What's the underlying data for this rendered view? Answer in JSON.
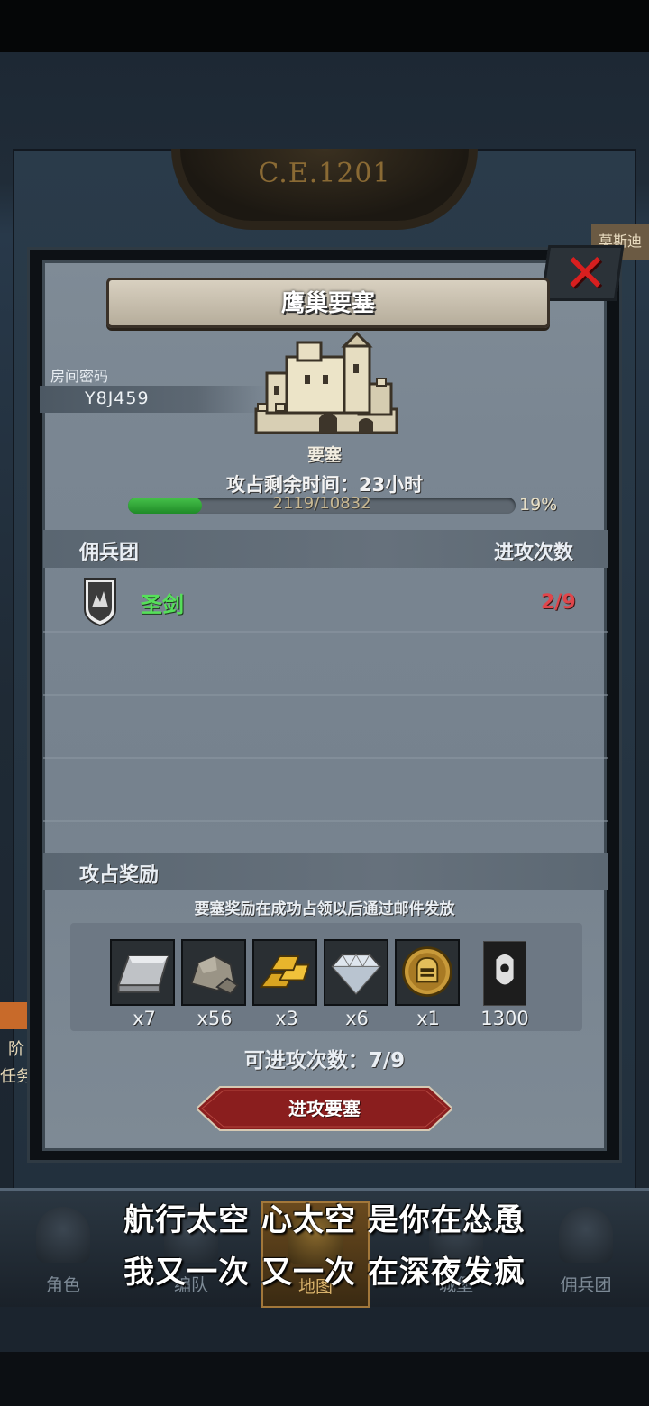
{
  "background": {
    "era": "C.E.1201",
    "right_tab": "莫斯迪",
    "side_left": [
      "阶",
      "任务"
    ]
  },
  "modal": {
    "title": "鹰巢要塞",
    "room_password_label": "房间密码",
    "room_password_value": "Y8J459",
    "fortress_name": "要塞",
    "timer_label": "攻占剩余时间：23小时",
    "progress": {
      "current": 2119,
      "total": 10832,
      "text": "2119/10832",
      "percent_text": "19%",
      "percent": 19
    },
    "guild_section": {
      "title": "佣兵团",
      "right_label": "进攻次数",
      "rows": [
        {
          "name": "圣剑",
          "attacks": "2/9"
        }
      ]
    },
    "reward_section": {
      "title": "攻占奖励",
      "note": "要塞奖励在成功占领以后通过邮件发放",
      "items": [
        {
          "icon": "silver-ingot-icon",
          "qty": "x7"
        },
        {
          "icon": "stone-ore-icon",
          "qty": "x56"
        },
        {
          "icon": "gold-bars-icon",
          "qty": "x3"
        },
        {
          "icon": "diamond-icon",
          "qty": "x6"
        },
        {
          "icon": "knight-helmet-medal-icon",
          "qty": "x1"
        },
        {
          "icon": "honor-banner-icon",
          "qty": "1300"
        }
      ]
    },
    "available_attacks": "可进攻次数：7/9",
    "attack_button": "进攻要塞"
  },
  "nav": {
    "items": [
      {
        "label": "角色",
        "icon": "hero-icon"
      },
      {
        "label": "编队",
        "icon": "formation-icon"
      },
      {
        "label": "地图",
        "icon": "map-icon",
        "active": true
      },
      {
        "label": "城堡",
        "icon": "castle-icon"
      },
      {
        "label": "佣兵团",
        "icon": "mercenary-icon"
      }
    ]
  },
  "subtitle": {
    "line1": "航行太空 心太空 是你在怂恿",
    "line2": "我又一次 又一次 在深夜发疯"
  },
  "colors": {
    "accent_red": "#d81f1f",
    "guild_green": "#56e05a",
    "attack_red": "#e0464b",
    "progress_green": "#46c24a",
    "button_red": "#8a1e1e"
  }
}
